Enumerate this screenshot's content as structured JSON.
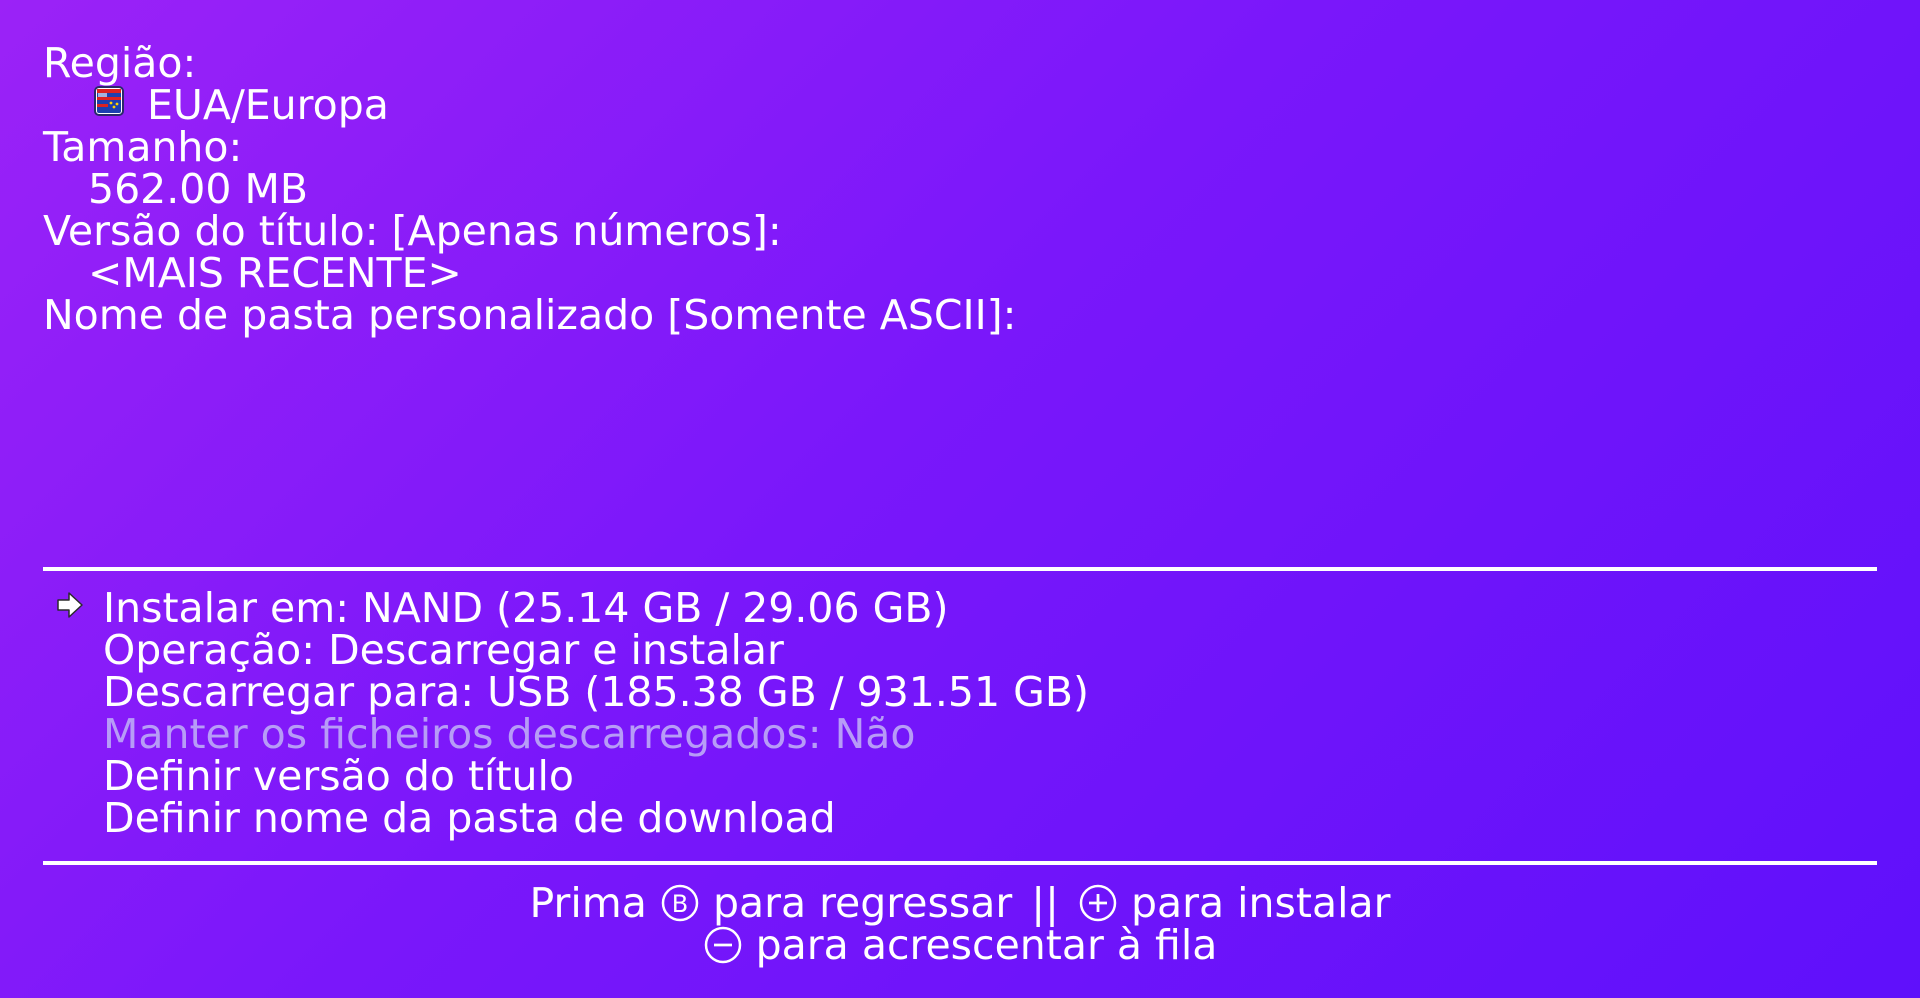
{
  "info": {
    "region_label": "Região:",
    "region_value": "EUA/Europa",
    "region_icon": "flag-usa-europe-icon",
    "size_label": "Tamanho:",
    "size_value": "562.00 MB",
    "version_label": "Versão do título: [Apenas números]:",
    "version_value": "<MAIS RECENTE>",
    "folder_label": "Nome de pasta personalizado [Somente ASCII]:",
    "folder_value": ""
  },
  "menu": {
    "items": [
      {
        "label": "Instalar em: NAND (25.14 GB / 29.06 GB)",
        "selected": true,
        "enabled": true
      },
      {
        "label": "Operação: Descarregar e instalar",
        "selected": false,
        "enabled": true
      },
      {
        "label": "Descarregar para: USB (185.38 GB / 931.51 GB)",
        "selected": false,
        "enabled": true
      },
      {
        "label": "Manter os ficheiros descarregados: Não",
        "selected": false,
        "enabled": false
      },
      {
        "label": "Definir versão do título",
        "selected": false,
        "enabled": true
      },
      {
        "label": "Definir nome da pasta de download",
        "selected": false,
        "enabled": true
      }
    ]
  },
  "footer": {
    "line1_prefix": "Prima",
    "line1_b_text": "para regressar",
    "line1_separator": "||",
    "line1_plus_text": "para instalar",
    "line2_minus_text": "para acrescentar à fila",
    "icons": [
      "b-button-icon",
      "plus-button-icon",
      "minus-button-icon"
    ]
  },
  "colors": {
    "background_start": "#9b22f7",
    "background_end": "#5f10fb",
    "text": "#ffffff",
    "disabled_text": "#b79cf7"
  }
}
